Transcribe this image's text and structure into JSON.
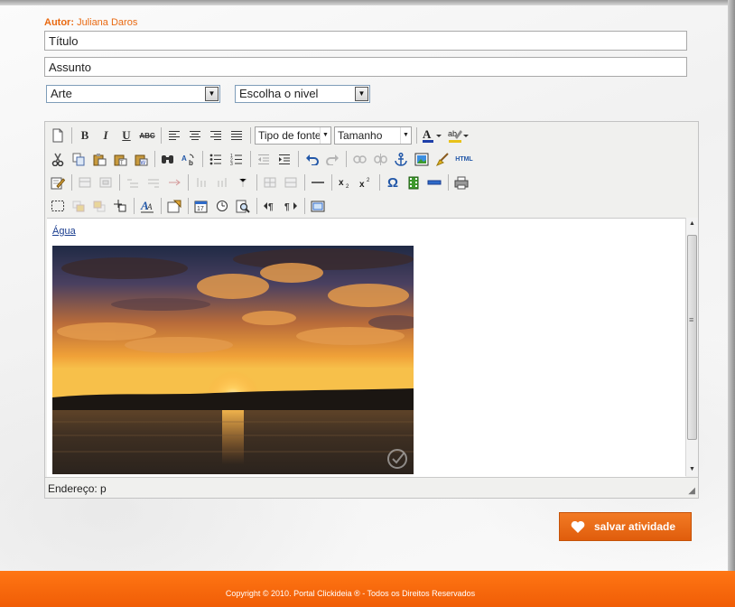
{
  "author": {
    "label": "Autor:",
    "name": "Juliana Daros"
  },
  "form": {
    "title_value": "Título",
    "subject_value": "Assunto",
    "subject_select": "Arte",
    "level_select": "Escolha o nivel"
  },
  "editor": {
    "toolbar": {
      "bold": "B",
      "italic": "I",
      "underline": "U",
      "strike": "ABC",
      "font_family": "Tipo de fonte",
      "font_size": "Tamanho",
      "html_label": "HTML"
    },
    "content_link": "Água",
    "status_path": "Endereço: p"
  },
  "save_button": {
    "label": "salvar atividade"
  },
  "footer": {
    "copyright": "Copyright © 2010. Portal Clickideia ® - Todos os Direitos Reservados"
  },
  "colors": {
    "accent": "#f06a10",
    "link": "#1a3d8f"
  }
}
